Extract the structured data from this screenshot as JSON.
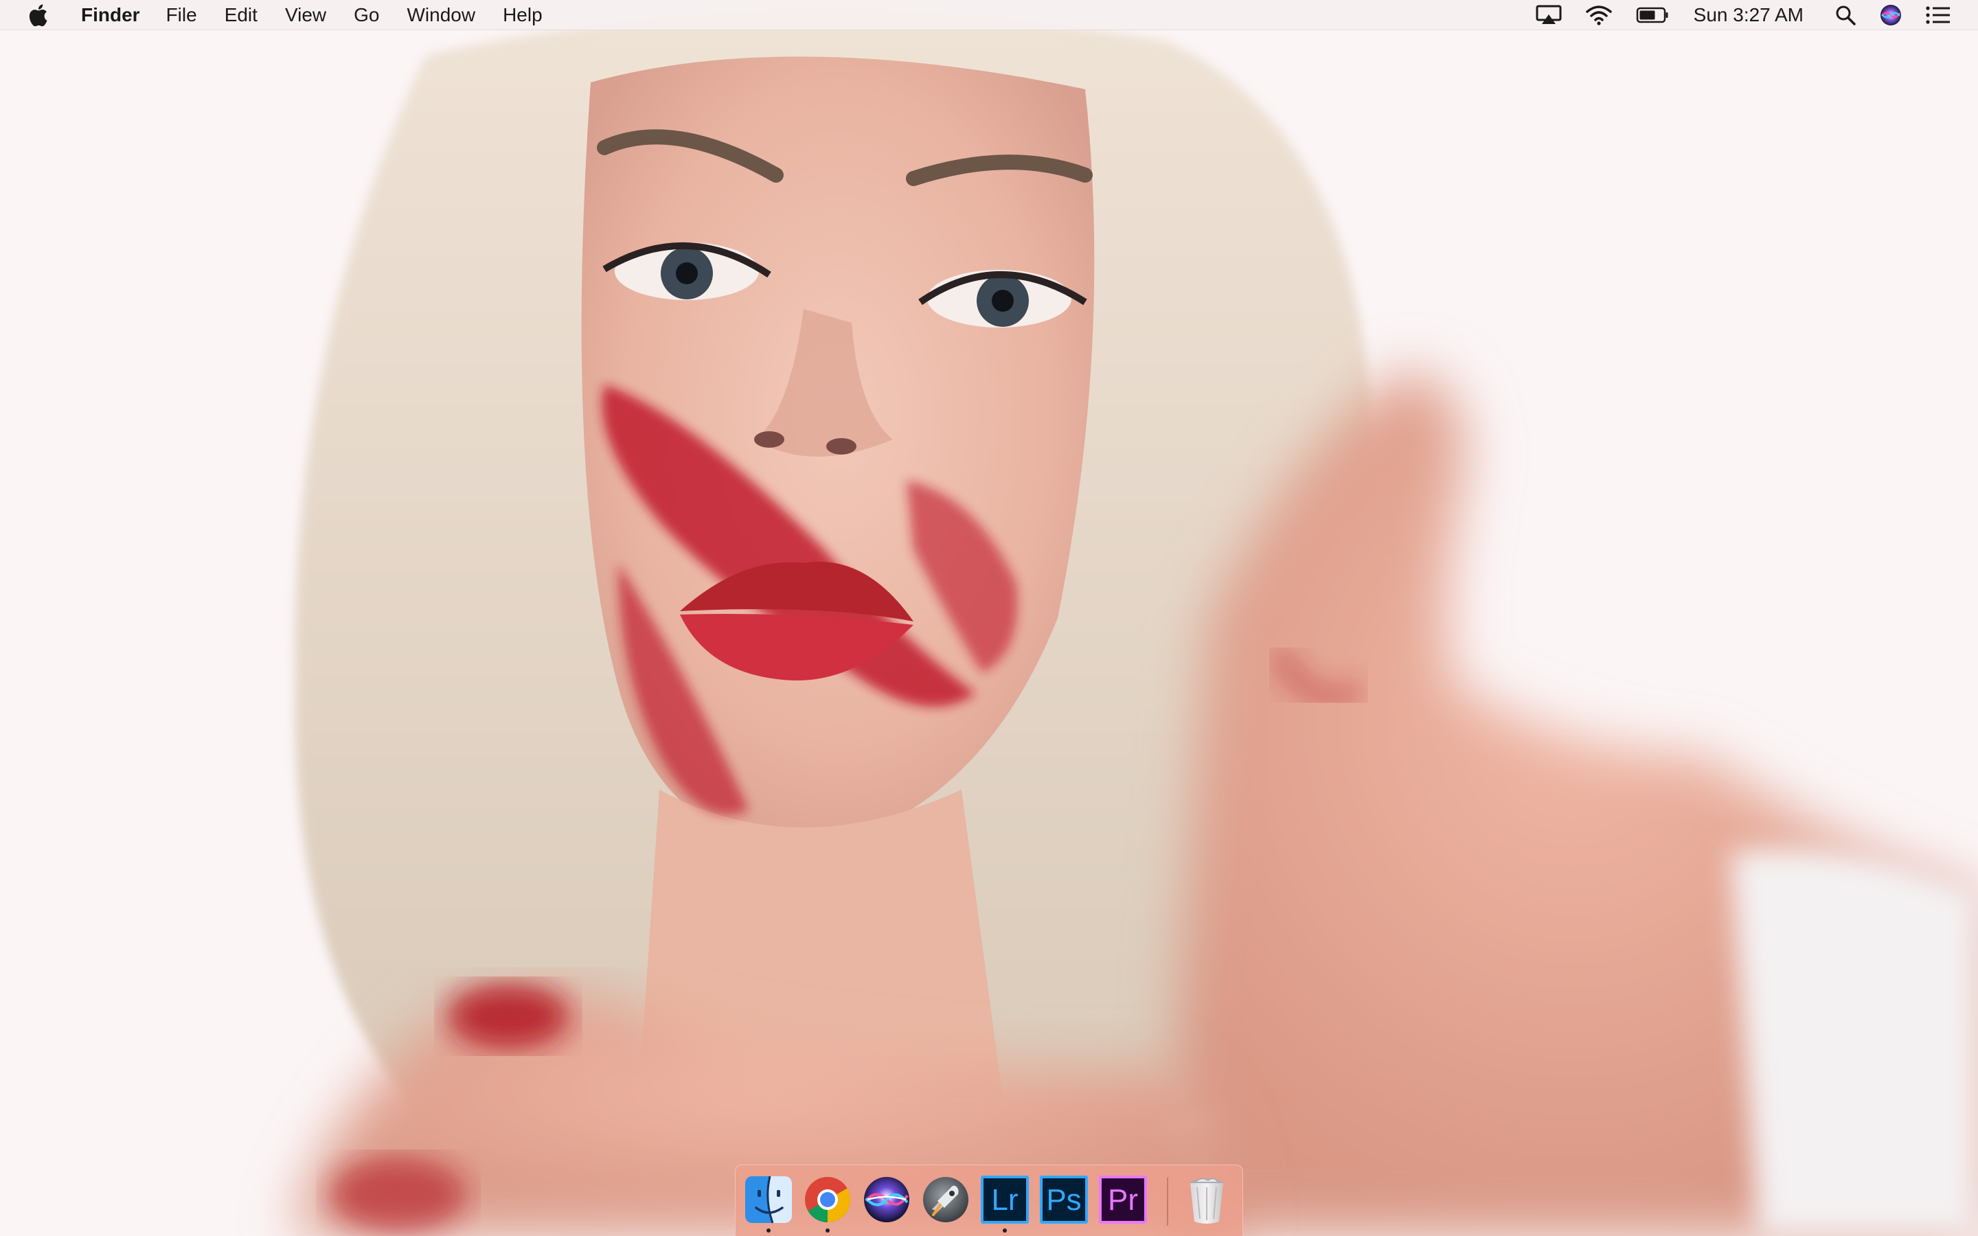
{
  "menubar": {
    "app_name": "Finder",
    "menus": [
      "File",
      "Edit",
      "View",
      "Go",
      "Window",
      "Help"
    ],
    "clock": "Sun 3:27 AM",
    "status_icons": [
      "airplay-icon",
      "wifi-icon",
      "battery-icon",
      "spotlight-icon",
      "siri-icon",
      "notification-center-icon"
    ]
  },
  "dock": {
    "apps": [
      {
        "name": "Finder",
        "icon": "finder-icon",
        "running": true
      },
      {
        "name": "Google Chrome",
        "icon": "chrome-icon",
        "running": true
      },
      {
        "name": "Siri",
        "icon": "siri-icon",
        "running": false
      },
      {
        "name": "Launchpad",
        "icon": "launchpad-icon",
        "running": false
      },
      {
        "name": "Lightroom",
        "icon": "lightroom-icon",
        "label": "Lr",
        "running": true
      },
      {
        "name": "Photoshop",
        "icon": "photoshop-icon",
        "label": "Ps",
        "running": false
      },
      {
        "name": "Premiere Pro",
        "icon": "premiere-icon",
        "label": "Pr",
        "running": false
      },
      {
        "name": "Trash",
        "icon": "trash-icon",
        "running": false
      }
    ]
  },
  "colors": {
    "dock_background": "#eca08c",
    "lightroom": "#31a8ff",
    "photoshop": "#31a8ff",
    "premiere": "#ea77ff",
    "lipstick": "#c0182a"
  }
}
